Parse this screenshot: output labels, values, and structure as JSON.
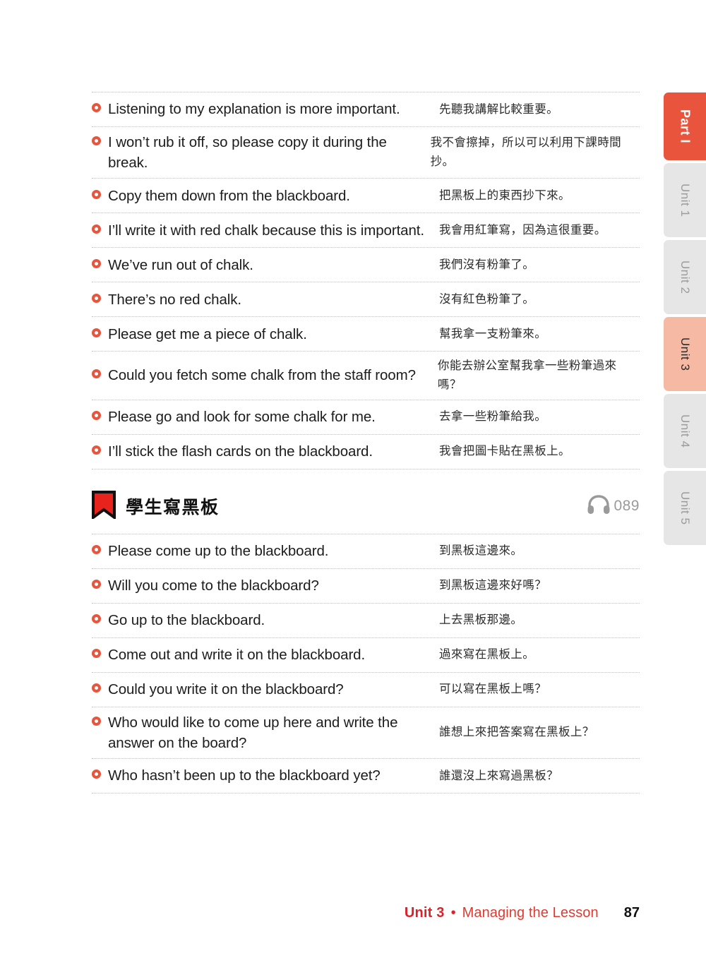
{
  "page": {
    "number": "87",
    "footer_unit": "Unit 3",
    "footer_separator": "•",
    "footer_title": "Managing the Lesson"
  },
  "side_tabs": [
    {
      "label": "Part I",
      "type": "part",
      "active": true
    },
    {
      "label": "Unit 1",
      "type": "unit",
      "active": false
    },
    {
      "label": "Unit 2",
      "type": "unit",
      "active": false
    },
    {
      "label": "Unit 3",
      "type": "unit",
      "active": true
    },
    {
      "label": "Unit 4",
      "type": "unit",
      "active": false
    },
    {
      "label": "Unit 5",
      "type": "unit",
      "active": false
    }
  ],
  "colors": {
    "accent_orange": "#E8543C",
    "tab_active_peach": "#F5B9A4",
    "tab_inactive_gray": "#E6E6E6",
    "footer_red": "#E03A30",
    "bookmark_red": "#E8221C",
    "headphone_gray": "#9A9A9A"
  },
  "section_1": {
    "rows": [
      {
        "en": "Listening to my explanation is more important.",
        "zh": "先聽我講解比較重要。"
      },
      {
        "en": "I won’t rub it off, so please copy it during the break.",
        "zh": "我不會擦掉，所以可以利用下課時間抄。"
      },
      {
        "en": "Copy them down from the blackboard.",
        "zh": "把黑板上的東西抄下來。"
      },
      {
        "en": "I’ll write it with red chalk because this is important.",
        "zh": "我會用紅筆寫，因為這很重要。"
      },
      {
        "en": "We’ve run out of chalk.",
        "zh": "我們沒有粉筆了。"
      },
      {
        "en": "There’s no red chalk.",
        "zh": "沒有紅色粉筆了。"
      },
      {
        "en": "Please get me a piece of chalk.",
        "zh": "幫我拿一支粉筆來。"
      },
      {
        "en": "Could you fetch some chalk from the staff room?",
        "zh": "你能去辦公室幫我拿一些粉筆過來嗎？"
      },
      {
        "en": "Please go and look for some chalk for me.",
        "zh": "去拿一些粉筆給我。"
      },
      {
        "en": "I’ll stick the flash cards on the blackboard.",
        "zh": "我會把圖卡貼在黑板上。"
      }
    ]
  },
  "section_2": {
    "header": {
      "bookmark_icon": "bookmark-icon",
      "title": "學生寫黑板",
      "headphone_icon": "headphone-icon",
      "track": "089"
    },
    "rows": [
      {
        "en": "Please come up to the blackboard.",
        "zh": "到黑板這邊來。"
      },
      {
        "en": "Will you come to the blackboard?",
        "zh": "到黑板這邊來好嗎？"
      },
      {
        "en": "Go up to the blackboard.",
        "zh": "上去黑板那邊。"
      },
      {
        "en": "Come out and write it on the blackboard.",
        "zh": "過來寫在黑板上。"
      },
      {
        "en": "Could you write it on the blackboard?",
        "zh": "可以寫在黑板上嗎？"
      },
      {
        "en": "Who would like to come up here and write the answer on the board?",
        "zh": "誰想上來把答案寫在黑板上？"
      },
      {
        "en": "Who hasn’t been up to the blackboard yet?",
        "zh": "誰還沒上來寫過黑板？"
      }
    ]
  }
}
